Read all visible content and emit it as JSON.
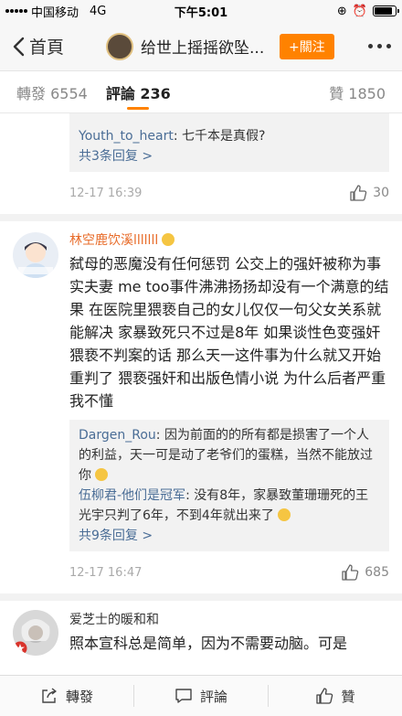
{
  "status": {
    "carrier": "中国移动",
    "network": "4G",
    "time": "下午5:01"
  },
  "nav": {
    "back_label": "首頁",
    "title": "给世上摇摇欲坠...",
    "follow_label": "+關注"
  },
  "tabs": {
    "repost": "轉發 6554",
    "comments": "評論 236",
    "likes": "贊 1850"
  },
  "top_card": {
    "reply_user": "Youth_to_heart",
    "reply_text": ": 七千本是真假?",
    "more_replies": "共3条回复 >",
    "date": "12-17 16:39",
    "likes": "30"
  },
  "comment1": {
    "author": "林空鹿饮溪lllllll",
    "text": "弑母的恶魔没有任何惩罚 公交上的强奸被称为事实夫妻 me too事件沸沸扬扬却没有一个满意的结果 在医院里猥亵自己的女儿仅仅一句父女关系就能解决 家暴致死只不过是8年 如果谈性色变强奸猥亵不判案的话 那么天一这件事为什么就又开始重判了 猥亵强奸和出版色情小说 为什么后者严重 我不懂",
    "reply1_user": "Dargen_Rou",
    "reply1_text": ": 因为前面的的所有都是损害了一个人的利益，天一可是动了老爷们的蛋糕，当然不能放过你",
    "reply2_user": "伍柳君-他们是冠军",
    "reply2_text": ": 没有8年，家暴致董珊珊死的王光宇只判了6年，不到4年就出来了",
    "more_replies": "共9条回复 >",
    "date": "12-17 16:47",
    "likes": "685"
  },
  "comment2": {
    "author": "爱芝士的暖和和",
    "text": "照本宣科总是简单，因为不需要动脑。可是"
  },
  "bottom": {
    "repost": "轉發",
    "comment": "評論",
    "like": "贊"
  }
}
